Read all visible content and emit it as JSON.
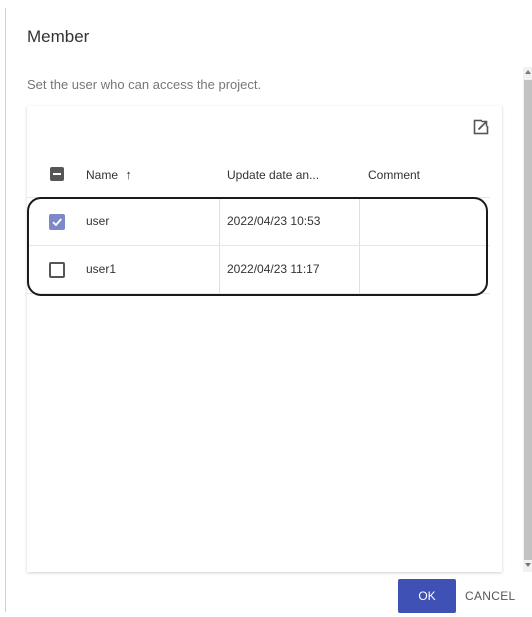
{
  "dialog": {
    "title": "Member",
    "description": "Set the user who can access the project."
  },
  "table": {
    "columns": {
      "name": "Name",
      "sort_arrow": "↑",
      "update_date": "Update date an...",
      "comment": "Comment"
    },
    "rows": [
      {
        "checked": true,
        "name": "user",
        "update_date": "2022/04/23 10:53",
        "comment": ""
      },
      {
        "checked": false,
        "name": "user1",
        "update_date": "2022/04/23 11:17",
        "comment": ""
      }
    ]
  },
  "footer": {
    "ok_label": "OK",
    "cancel_label": "CANCEL"
  },
  "icons": {
    "open_in_new": "open-in-new-icon",
    "checkbox_indeterminate": "indeterminate-checkbox-icon",
    "check": "checkmark-icon"
  },
  "colors": {
    "primary": "#3f51b5",
    "checked_checkbox": "#7d88c8",
    "highlight_border": "#1a1a1a"
  }
}
